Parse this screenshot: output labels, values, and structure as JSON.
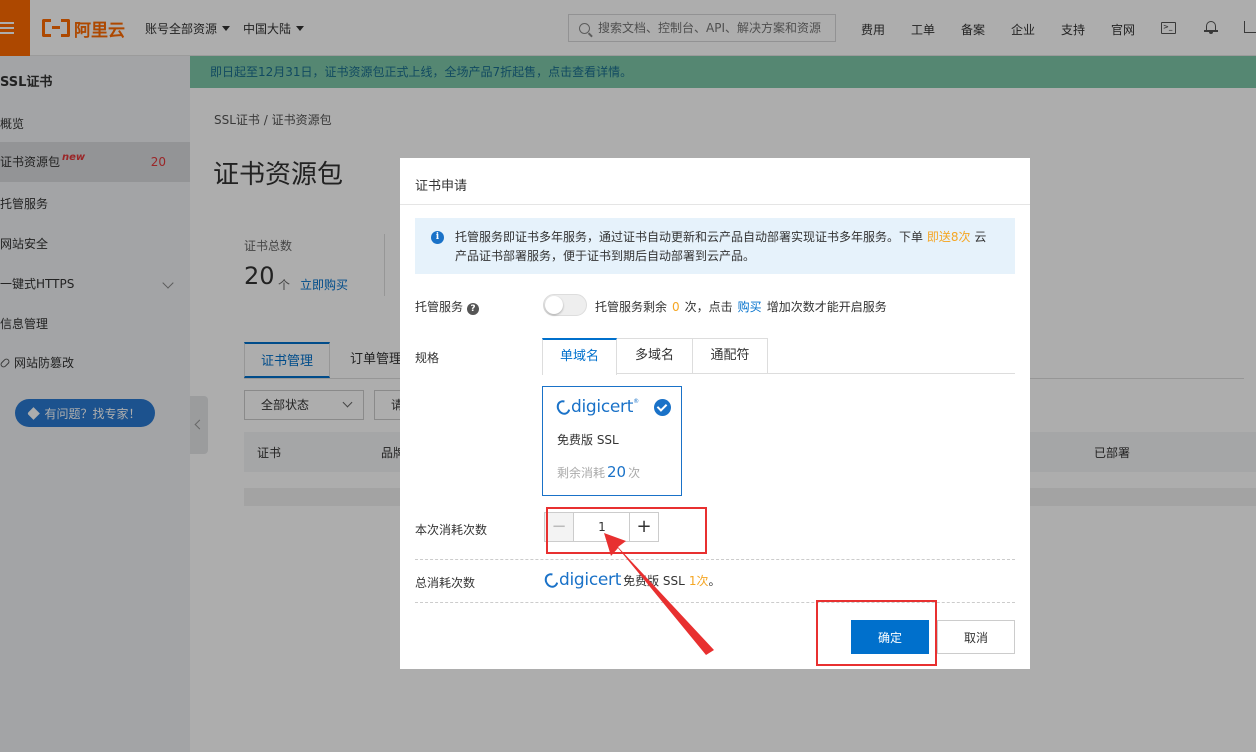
{
  "topbar": {
    "logo_text": "阿里云",
    "account_dropdown": "账号全部资源",
    "region_dropdown": "中国大陆",
    "search_placeholder": "搜索文档、控制台、API、解决方案和资源",
    "nav": [
      "费用",
      "工单",
      "备案",
      "企业",
      "支持",
      "官网"
    ],
    "terminal_glyph": ">_"
  },
  "sidebar": {
    "title": "SSL证书",
    "items": [
      {
        "label": "概览"
      },
      {
        "label": "证书资源包",
        "badge": "new",
        "count": "20"
      },
      {
        "label": "托管服务"
      },
      {
        "label": "网站安全"
      },
      {
        "label": "一键式HTTPS"
      },
      {
        "label": "信息管理"
      },
      {
        "label": "网站防篡改"
      }
    ],
    "expert_button": "有问题？找专家！"
  },
  "notice": "即日起至12月31日，证书资源包正式上线，全场产品7折起售，点击查看详情。",
  "main": {
    "breadcrumb": "SSL证书  /  证书资源包",
    "title": "证书资源包",
    "stat_label": "证书总数",
    "stat_value": "20",
    "stat_unit": "个",
    "stat_link": "立即购买",
    "tabs": [
      "证书管理",
      "订单管理"
    ],
    "filter_status": "全部状态",
    "filter_input_partial": "请",
    "table_headers": [
      "证书",
      "品牌",
      "已部署"
    ]
  },
  "modal": {
    "title": "证书申请",
    "info_text_1": "托管服务即证书多年服务，通过证书自动更新和云产品自动部署实现证书多年服务。下单",
    "info_highlight": "即送8次",
    "info_text_2": "云",
    "info_text_3": "产品证书部署服务，便于证书到期后自动部署到云产品。",
    "hosting_label": "托管服务",
    "help_glyph": "?",
    "hosting_prefix": "托管服务剩余",
    "hosting_count": "0",
    "hosting_mid": "次，点击",
    "hosting_link": "购买",
    "hosting_suffix": "增加次数才能开启服务",
    "spec_label": "规格",
    "spec_tabs": [
      "单域名",
      "多域名",
      "通配符"
    ],
    "card": {
      "brand": "digicert",
      "reg": "®",
      "name": "免费版 SSL",
      "remain_prefix": "剩余消耗",
      "remain_count": "20",
      "remain_suffix": "次"
    },
    "consume_label": "本次消耗次数",
    "stepper_minus": "−",
    "stepper_value": "1",
    "stepper_plus": "+",
    "total_label": "总消耗次数",
    "total_brand": "digicert",
    "total_product": "免费版 SSL",
    "total_count": "1次",
    "total_end": "。",
    "confirm": "确定",
    "cancel": "取消"
  },
  "colors": {
    "brand_orange": "#ff6a00",
    "primary_blue": "#0070cc",
    "highlight": "#f5a623",
    "annotation_red": "#e83030",
    "notice_bg": "#7ec7a8"
  }
}
